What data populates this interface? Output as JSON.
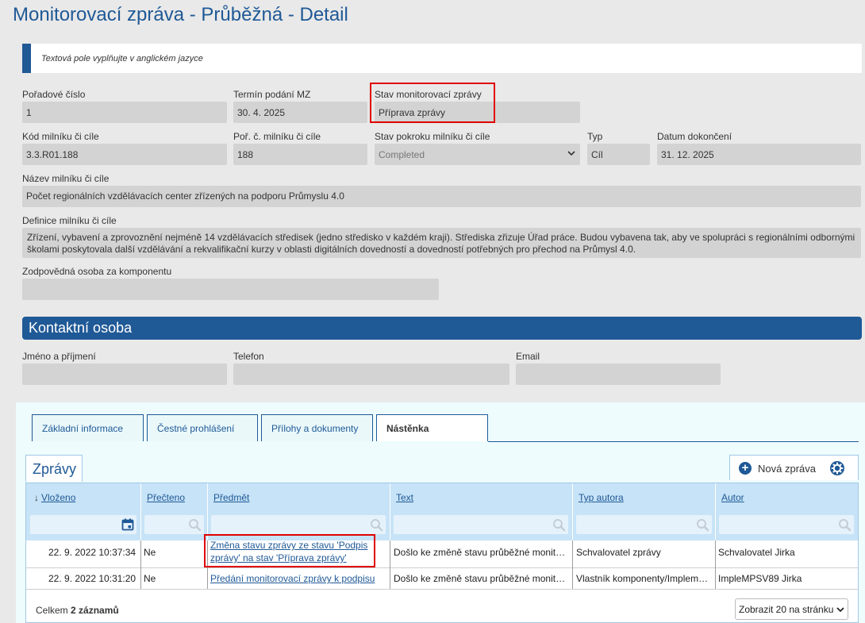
{
  "page": {
    "title": "Monitorovací zpráva - Průběžná - Detail",
    "notice": "Textová pole vyplňujte v anglickém jazyce"
  },
  "fields": {
    "poradove_cislo": {
      "label": "Pořadové číslo",
      "value": "1"
    },
    "termin_podani": {
      "label": "Termín podání MZ",
      "value": "30. 4. 2025"
    },
    "stav_zpravy": {
      "label": "Stav monitorovací zprávy",
      "value": "Příprava zprávy"
    },
    "kod_milniku": {
      "label": "Kód milníku či cíle",
      "value": "3.3.R01.188"
    },
    "por_c_milniku": {
      "label": "Poř. č. milníku či cíle",
      "value": "188"
    },
    "stav_pokroku": {
      "label": "Stav pokroku milníku či cíle",
      "value": "Completed"
    },
    "typ": {
      "label": "Typ",
      "value": "Cíl"
    },
    "datum_dokonceni": {
      "label": "Datum dokončení",
      "value": "31. 12. 2025"
    },
    "nazev_milniku": {
      "label": "Název milníku či cíle",
      "value": "Počet regionálních vzdělávacích center zřízených na podporu Průmyslu 4.0"
    },
    "definice_milniku": {
      "label": "Definice milníku či cíle",
      "value": "Zřízení, vybavení a zprovoznění nejméně 14 vzdělávacích středisek (jedno středisko v každém kraji). Střediska zřizuje Úřad práce. Budou vybavena tak, aby ve spolupráci s regionálními odbornými školami poskytovala další vzdělávání a rekvalifikační kurzy v oblasti digitálních dovedností a dovedností potřebných pro přechod na Průmysl 4.0."
    },
    "zodpovedna_osoba": {
      "label": "Zodpovědná osoba za komponentu",
      "value": ""
    }
  },
  "contact": {
    "section_title": "Kontaktní osoba",
    "name_label": "Jméno a příjmení",
    "name_value": "",
    "phone_label": "Telefon",
    "phone_value": "",
    "email_label": "Email",
    "email_value": ""
  },
  "tabs": [
    {
      "label": "Základní informace",
      "active": false
    },
    {
      "label": "Čestné prohlášení",
      "active": false
    },
    {
      "label": "Přílohy a dokumenty",
      "active": false
    },
    {
      "label": "Nástěnka",
      "active": true
    }
  ],
  "messages": {
    "subtab_label": "Zprávy",
    "new_button_label": "Nová zpráva",
    "columns": [
      "Vloženo",
      "Přečteno",
      "Předmět",
      "Text",
      "Typ autora",
      "Autor"
    ],
    "sort_indicator": "↓",
    "rows": [
      {
        "vlozeno": "22. 9. 2022 10:37:34",
        "precteno": "Ne",
        "predmet": "Změna stavu zprávy ze stavu 'Podpis zprávy' na stav 'Příprava zprávy'",
        "text": "Došlo ke změně stavu průběžné monitorovací zprávy",
        "typ_autora": "Schvalovatel zprávy",
        "autor": "Schvalovatel Jirka"
      },
      {
        "vlozeno": "22. 9. 2022 10:31:20",
        "precteno": "Ne",
        "predmet": "Předání monitorovací zprávy k podpisu",
        "text": "Došlo ke změně stavu průběžné monitorovací zprávy",
        "typ_autora": "Vlastník komponenty/Implementátor",
        "autor": "ImpleMPSV89 Jirka"
      }
    ],
    "total_prefix": "Celkem",
    "total_count": "2 záznamů",
    "page_size_label": "Zobrazit 20 na stránku"
  },
  "colors": {
    "brand": "#1f5996",
    "highlight": "#e00000",
    "field_bg": "#d3d3d3",
    "grid_header": "#c7e3f7"
  }
}
